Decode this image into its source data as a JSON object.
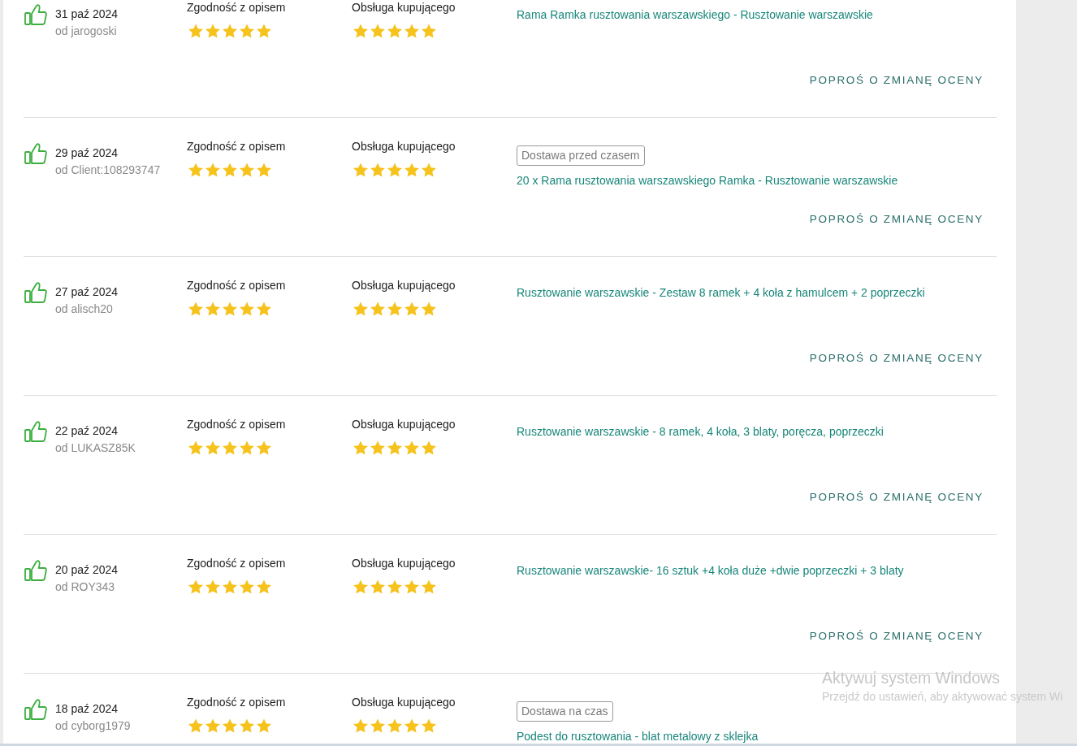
{
  "reviews": [
    {
      "recommended": true,
      "date": "31 paź 2024",
      "author": "od jarogoski",
      "ratings": [
        {
          "label": "Zgodność z opisem",
          "stars": 5
        },
        {
          "label": "Obsługa kupującego",
          "stars": 5
        }
      ],
      "product": "Rama Ramka rusztowania warszawskiego - Rusztowanie warszawskie",
      "action": "POPROŚ O ZMIANĘ OCENY"
    },
    {
      "recommended": true,
      "date": "29 paź 2024",
      "author": "od Client:108293747",
      "ratings": [
        {
          "label": "Zgodność z opisem",
          "stars": 5
        },
        {
          "label": "Obsługa kupującego",
          "stars": 5
        }
      ],
      "delivery_badge": "Dostawa przed czasem",
      "product": "20 x Rama rusztowania warszawskiego Ramka - Rusztowanie warszawskie",
      "action": "POPROŚ O ZMIANĘ OCENY"
    },
    {
      "recommended": true,
      "date": "27 paź 2024",
      "author": "od alisch20",
      "ratings": [
        {
          "label": "Zgodność z opisem",
          "stars": 5
        },
        {
          "label": "Obsługa kupującego",
          "stars": 5
        }
      ],
      "product": "Rusztowanie warszawskie - Zestaw 8 ramek + 4 koła z hamulcem + 2 poprzeczki",
      "action": "POPROŚ O ZMIANĘ OCENY"
    },
    {
      "recommended": true,
      "date": "22 paź 2024",
      "author": "od LUKASZ85K",
      "ratings": [
        {
          "label": "Zgodność z opisem",
          "stars": 5
        },
        {
          "label": "Obsługa kupującego",
          "stars": 5
        }
      ],
      "product": "Rusztowanie warszawskie - 8 ramek, 4 koła, 3 blaty, poręcza, poprzeczki",
      "action": "POPROŚ O ZMIANĘ OCENY"
    },
    {
      "recommended": true,
      "date": "20 paź 2024",
      "author": "od ROY343",
      "ratings": [
        {
          "label": "Zgodność z opisem",
          "stars": 5
        },
        {
          "label": "Obsługa kupującego",
          "stars": 5
        }
      ],
      "product": "Rusztowanie warszawskie- 16 sztuk +4 koła duże +dwie poprzeczki + 3 blaty",
      "action": "POPROŚ O ZMIANĘ OCENY"
    },
    {
      "recommended": true,
      "date": "18 paź 2024",
      "author": "od cyborg1979",
      "ratings": [
        {
          "label": "Zgodność z opisem",
          "stars": 5
        },
        {
          "label": "Obsługa kupującego",
          "stars": 5
        }
      ],
      "delivery_badge": "Dostawa na czas",
      "product": "Podest do rusztowania - blat metalowy z sklejka"
    }
  ],
  "os_watermark": {
    "title": "Aktywuj system Windows",
    "text": "Przejdź do ustawień, aby aktywować system Wi"
  }
}
